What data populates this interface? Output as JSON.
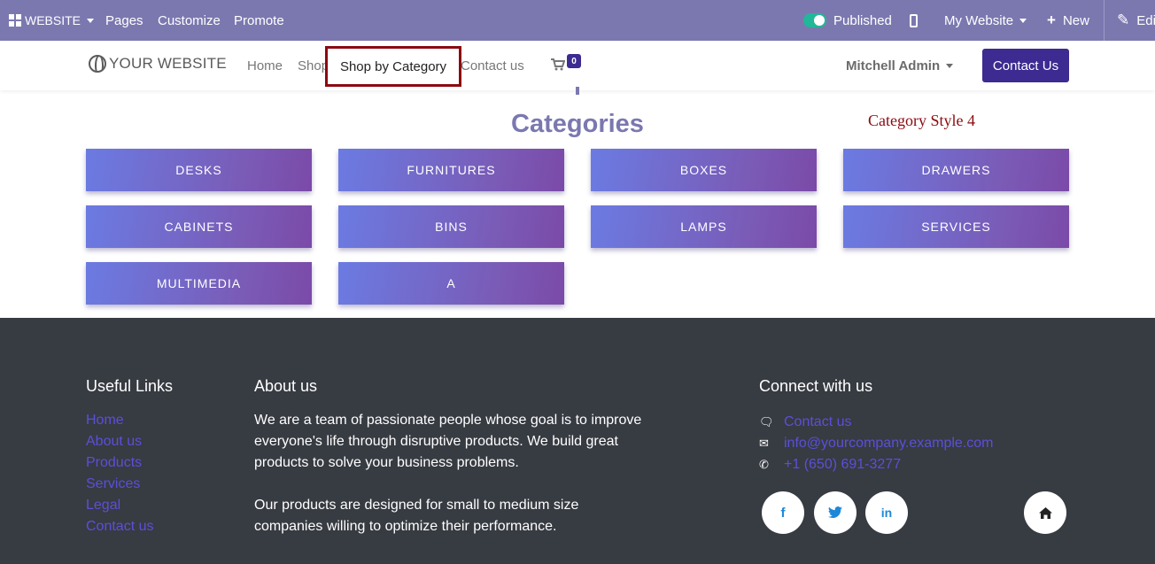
{
  "adminbar": {
    "website_label": "WEBSITE",
    "pages_label": "Pages",
    "customize_label": "Customize",
    "promote_label": "Promote",
    "published_label": "Published",
    "my_website_label": "My Website",
    "new_label": "New",
    "edit_label": "Edit"
  },
  "header": {
    "logo_text": "YOUR WEBSITE",
    "nav": [
      "Home",
      "Shop",
      "Shop by Category",
      "Contact us"
    ],
    "cart_count": "0",
    "user_name": "Mitchell Admin",
    "contact_button": "Contact Us"
  },
  "main": {
    "heading": "Categories",
    "style_label": "Category Style 4",
    "categories": [
      "DESKS",
      "FURNITURES",
      "BOXES",
      "DRAWERS",
      "CABINETS",
      "BINS",
      "LAMPS",
      "SERVICES",
      "MULTIMEDIA",
      "A"
    ]
  },
  "footer": {
    "useful_links_title": "Useful Links",
    "useful_links": [
      "Home",
      "About us",
      "Products",
      "Services",
      "Legal",
      "Contact us"
    ],
    "about_title": "About us",
    "about_p1": "We are a team of passionate people whose goal is to improve everyone's life through disruptive products. We build great products to solve your business problems.",
    "about_p2": "Our products are designed for small to medium size companies willing to optimize their performance.",
    "connect_title": "Connect with us",
    "connect": {
      "contact": "Contact us",
      "email": "info@yourcompany.example.com",
      "phone": "+1 (650) 691-3277"
    },
    "social_icons": [
      "facebook-icon",
      "twitter-icon",
      "linkedin-icon",
      "home-icon"
    ]
  },
  "colors": {
    "admin_bar": "#7b78b0",
    "accent": "#3d2b91",
    "highlight_border": "#8b0a10",
    "footer_bg": "#373b42",
    "link": "#5b4fd9"
  }
}
